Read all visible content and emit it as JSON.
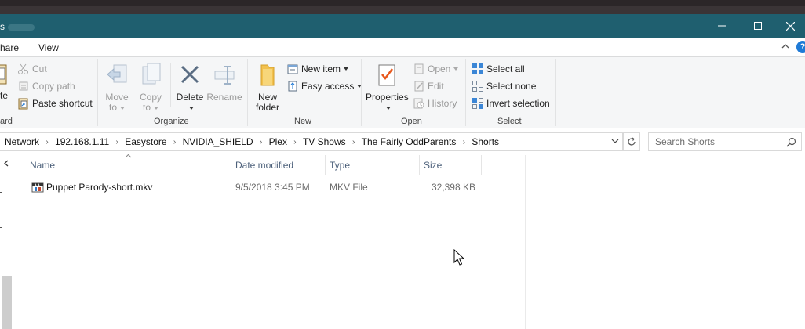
{
  "window": {
    "title": "s",
    "controls": {
      "minimize": "minimize-icon",
      "maximize": "maximize-icon",
      "close": "close-icon"
    }
  },
  "ribbon_tabs": {
    "share": "hare",
    "view": "View"
  },
  "ribbon": {
    "clipboard": {
      "paste_partial": "te",
      "cut": "Cut",
      "copy_path": "Copy path",
      "paste_shortcut": "Paste shortcut",
      "label_partial": "ard"
    },
    "organize": {
      "move_to_line1": "Move",
      "move_to_line2": "to",
      "copy_to_line1": "Copy",
      "copy_to_line2": "to",
      "delete": "Delete",
      "rename": "Rename",
      "label": "Organize"
    },
    "new": {
      "new_folder_line1": "New",
      "new_folder_line2": "folder",
      "new_item": "New item",
      "easy_access": "Easy access",
      "label": "New"
    },
    "open": {
      "properties": "Properties",
      "open": "Open",
      "edit": "Edit",
      "history": "History",
      "label": "Open"
    },
    "select": {
      "select_all": "Select all",
      "select_none": "Select none",
      "invert_selection": "Invert selection",
      "label": "Select"
    }
  },
  "address": {
    "breadcrumbs": [
      "Network",
      "192.168.1.11",
      "Easystore",
      "NVIDIA_SHIELD",
      "Plex",
      "TV Shows",
      "The Fairly OddParents",
      "Shorts"
    ],
    "search_placeholder": "Search Shorts"
  },
  "columns": {
    "name": "Name",
    "date": "Date modified",
    "type": "Type",
    "size": "Size"
  },
  "files": [
    {
      "name": "Puppet Parody-short.mkv",
      "date": "9/5/2018 3:45 PM",
      "type": "MKV File",
      "size": "32,398 KB",
      "icon": "video-file-icon"
    }
  ],
  "colors": {
    "titlebar": "#1f5f6f",
    "ribbon_bg": "#f5f6f7",
    "header_text": "#4c607a",
    "accent": "#1f7ad6"
  }
}
